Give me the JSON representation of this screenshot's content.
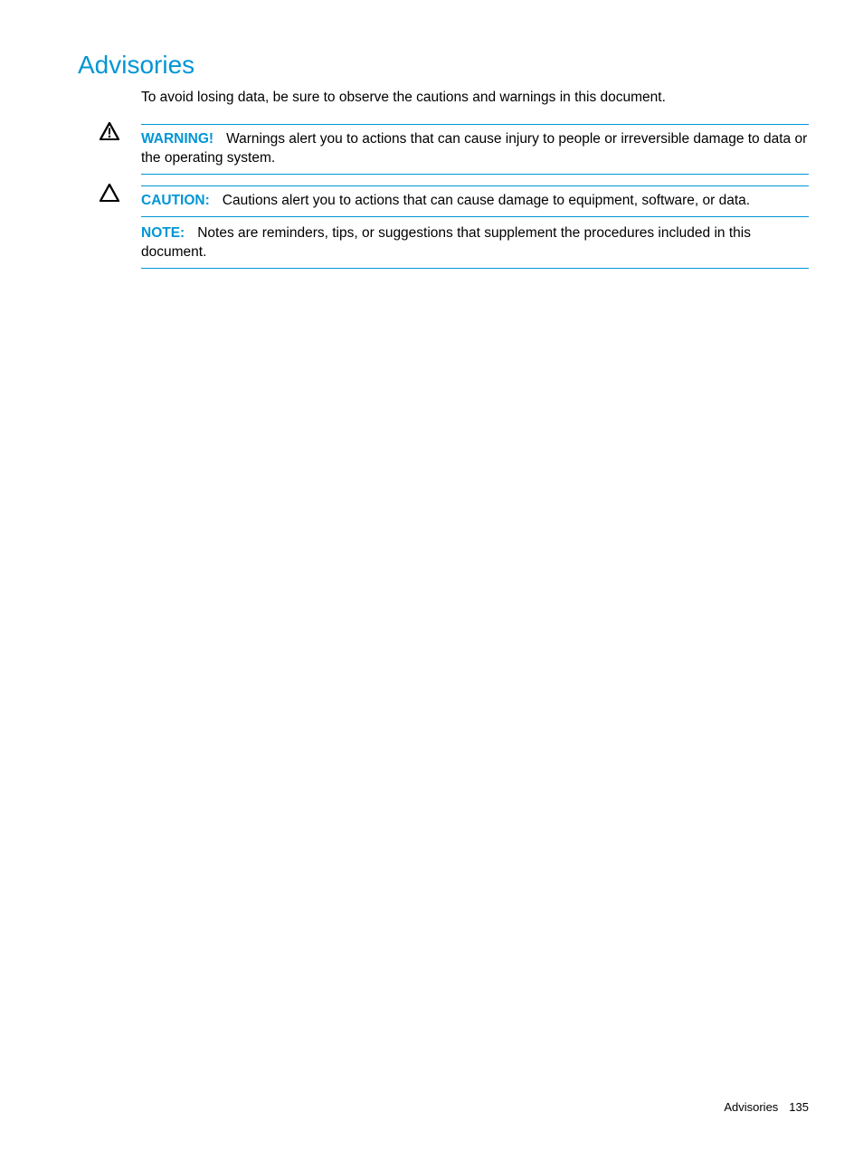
{
  "heading": "Advisories",
  "intro": "To avoid losing data, be sure to observe the cautions and warnings in this document.",
  "warning": {
    "label": "WARNING!",
    "text": "Warnings alert you to actions that can cause injury to people or irreversible damage to data or the operating system."
  },
  "caution": {
    "label": "CAUTION:",
    "text": "Cautions alert you to actions that can cause damage to equipment, software, or data."
  },
  "note": {
    "label": "NOTE:",
    "text": "Notes are reminders, tips, or suggestions that supplement the procedures included in this document."
  },
  "footer": {
    "section": "Advisories",
    "page": "135"
  }
}
